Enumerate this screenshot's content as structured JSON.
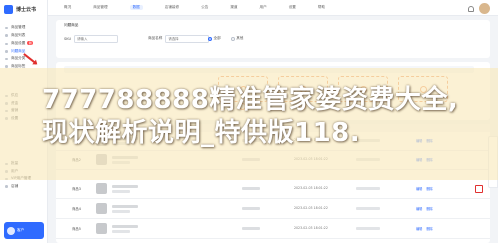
{
  "app": {
    "logo_text": "博士云书"
  },
  "sidebar": {
    "groups": [
      {
        "items": [
          {
            "label": "商品管理",
            "active": false
          },
          {
            "label": "商品列表",
            "active": false
          }
        ]
      },
      {
        "items": [
          {
            "label": "商品设置",
            "active": false,
            "badge": "新"
          },
          {
            "label": "问题商品",
            "active": true
          },
          {
            "label": "商品分类",
            "active": false
          },
          {
            "label": "商品标签",
            "active": false
          }
        ]
      },
      {
        "items": [
          {
            "label": "供应",
            "active": false
          },
          {
            "label": "资金",
            "active": false
          },
          {
            "label": "营销",
            "active": false
          },
          {
            "label": "设置",
            "active": false
          }
        ]
      },
      {
        "items": [
          {
            "label": "批量",
            "active": false
          },
          {
            "label": "用户",
            "active": false
          },
          {
            "label": "VIP用户管理",
            "active": false
          },
          {
            "label": "店铺",
            "active": false
          }
        ]
      }
    ],
    "promo_label": "客户"
  },
  "topbar": {
    "tabs": [
      "概况",
      "商品管理",
      "数据",
      "店铺装修",
      "公告",
      "渠道",
      "用户",
      "设置",
      "帮助"
    ],
    "active_tab_index": 2
  },
  "filter": {
    "title": "问题商品",
    "fields": [
      {
        "label": "SKU",
        "placeholder": "请输入"
      },
      {
        "label": "商品名称",
        "placeholder": "请选择"
      }
    ],
    "radio_options": [
      {
        "label": "全部",
        "selected": true
      },
      {
        "label": "其他",
        "selected": false
      }
    ]
  },
  "headline": "777788888精准管家婆资费大全,现状解析说明_特供版118.",
  "table": {
    "rows": [
      {
        "id": "商品1",
        "time": "2023-02-03 18:01:22",
        "actions": [
          "编辑",
          "删除"
        ]
      },
      {
        "id": "商品2",
        "time": "2023-02-03 18:01:22",
        "actions": [
          "编辑",
          "删除"
        ]
      },
      {
        "id": "商品3",
        "time": "2023-02-03 18:01:22",
        "actions": [
          "编辑",
          "删除"
        ]
      },
      {
        "id": "商品4",
        "time": "2023-02-03 18:01:22",
        "actions": [
          "编辑",
          "删除"
        ]
      },
      {
        "id": "商品5",
        "time": "2023-02-03 18:01:22",
        "actions": [
          "编辑",
          "删除"
        ]
      }
    ]
  },
  "colors": {
    "accent": "#2f6bff",
    "annotation": "#e0302f",
    "banner": "#f8e8ba"
  }
}
